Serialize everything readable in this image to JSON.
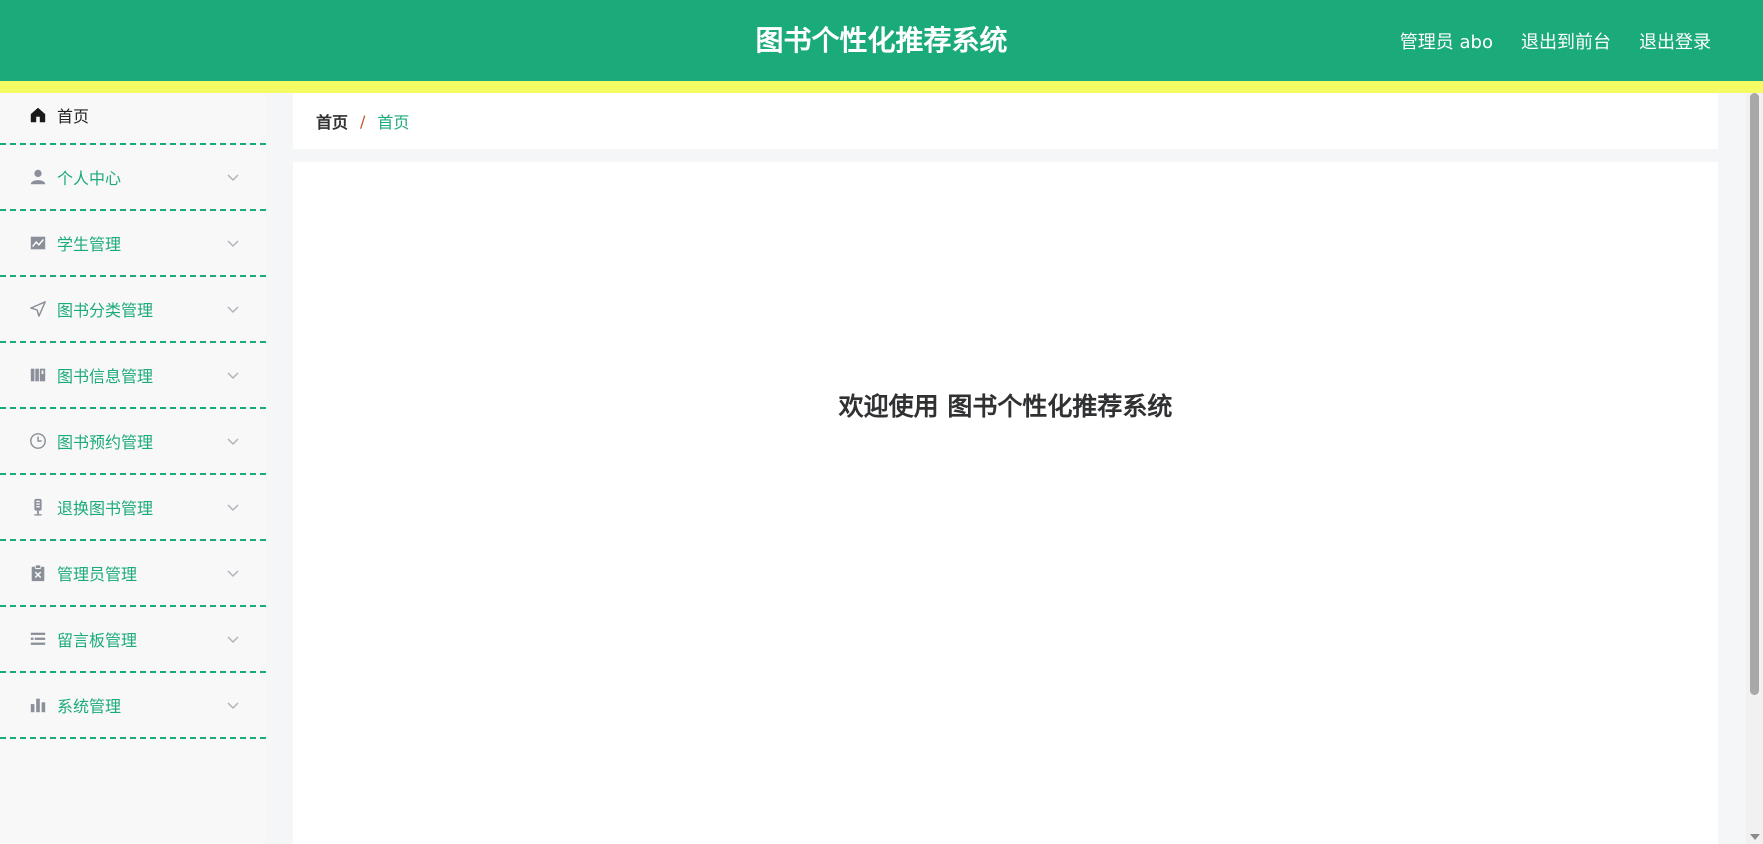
{
  "header": {
    "title": "图书个性化推荐系统",
    "user_label": "管理员 abo",
    "front_link": "退出到前台",
    "logout_link": "退出登录"
  },
  "sidebar": {
    "items": [
      {
        "label": "首页",
        "icon": "home-icon"
      },
      {
        "label": "个人中心",
        "icon": "user-icon"
      },
      {
        "label": "学生管理",
        "icon": "trend-chart-icon"
      },
      {
        "label": "图书分类管理",
        "icon": "send-arrow-icon"
      },
      {
        "label": "图书信息管理",
        "icon": "books-icon"
      },
      {
        "label": "图书预约管理",
        "icon": "clock-icon"
      },
      {
        "label": "退换图书管理",
        "icon": "microphone-icon"
      },
      {
        "label": "管理员管理",
        "icon": "clipboard-x-icon"
      },
      {
        "label": "留言板管理",
        "icon": "list-icon"
      },
      {
        "label": "系统管理",
        "icon": "bar-chart-icon"
      }
    ]
  },
  "breadcrumb": {
    "root": "首页",
    "separator": "/",
    "current": "首页"
  },
  "main": {
    "welcome": "欢迎使用 图书个性化推荐系统"
  },
  "colors": {
    "brand": "#1baa7a",
    "stripe": "#f5fb63",
    "separator": "#c0582f"
  }
}
